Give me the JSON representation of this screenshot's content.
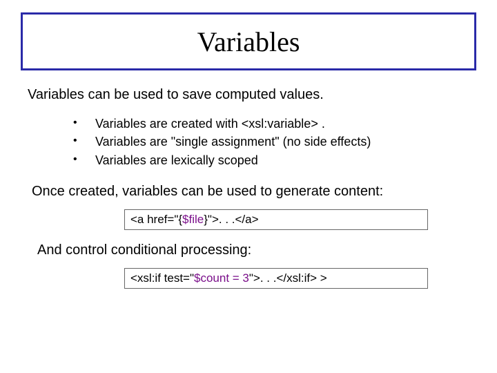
{
  "title": "Variables",
  "lead": "Variables can be used to save computed values.",
  "bullets": [
    "Variables are created with <xsl:variable> .",
    "Variables are \"single assignment\" (no side effects)",
    "Variables are lexically scoped"
  ],
  "para_generate": "Once created, variables can be used to generate content:",
  "code1": {
    "pre": "<a href=\"{",
    "var": "$file",
    "post": "}\">. . .</a>"
  },
  "para_conditional": "And control conditional processing:",
  "code2": {
    "pre": "<xsl:if test=\"",
    "expr": "$count = 3",
    "post": "\">. . .</xsl:if> >"
  }
}
